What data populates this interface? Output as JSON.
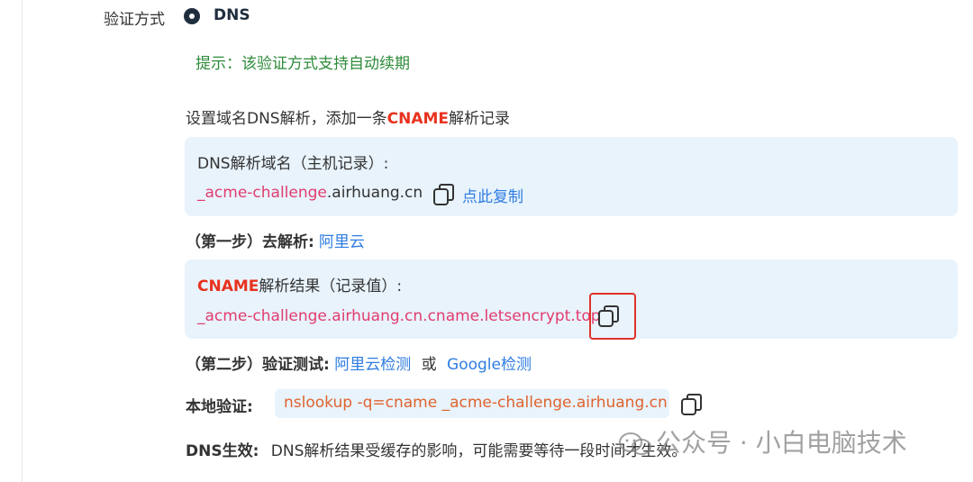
{
  "verification": {
    "method_label": "验证方式",
    "method_value": "DNS",
    "tip": "提示：该验证方式支持自动续期"
  },
  "instruction": {
    "prefix": "设置域名DNS解析，添加一条",
    "highlight": "CNAME",
    "suffix": "解析记录"
  },
  "host_record": {
    "title": "DNS解析域名（主机记录）:",
    "value_prefix": "_acme-challenge",
    "value_domain": ".airhuang.cn",
    "copy_link": "点此复制"
  },
  "step1": {
    "label": "（第一步）去解析:",
    "link": "阿里云"
  },
  "cname_result": {
    "title_highlight": "CNAME",
    "title_rest": "解析结果（记录值）:",
    "value": "_acme-challenge.airhuang.cn.cname.letsencrypt.top"
  },
  "step2": {
    "label": "（第二步）验证测试:",
    "link1": "阿里云检测",
    "or": "或",
    "link2": "Google检测"
  },
  "local_verify": {
    "label": "本地验证:",
    "command": "nslookup -q=cname _acme-challenge.airhuang.cn"
  },
  "dns_effect": {
    "label": "DNS生效:",
    "text": "DNS解析结果受缓存的影响，可能需要等待一段时间才生效。"
  },
  "watermark": {
    "text": "公众号 · 小白电脑技术",
    "icon": "wechat-icon"
  },
  "colors": {
    "accent_red": "#e8321e",
    "link_blue": "#2f7de1",
    "tip_green": "#2e8b3a",
    "code_pink": "#e23c6e",
    "panel_bg": "#e8f3fc"
  }
}
